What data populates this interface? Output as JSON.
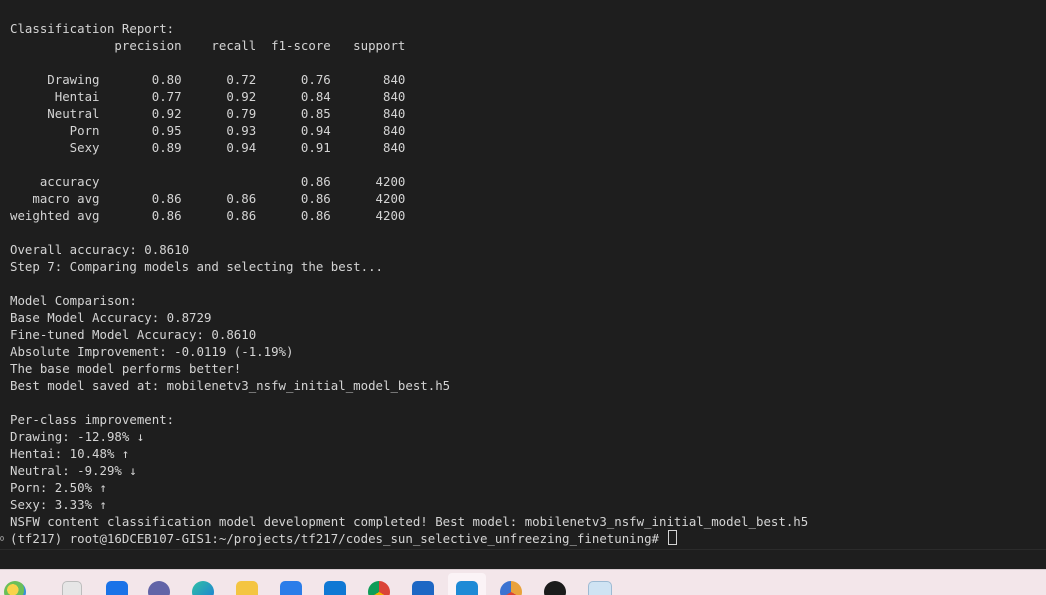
{
  "terminal": {
    "lines": [
      "Classification Report:",
      "              precision    recall  f1-score   support",
      "",
      "     Drawing       0.80      0.72      0.76       840",
      "      Hentai       0.77      0.92      0.84       840",
      "     Neutral       0.92      0.79      0.85       840",
      "        Porn       0.95      0.93      0.94       840",
      "        Sexy       0.89      0.94      0.91       840",
      "",
      "    accuracy                           0.86      4200",
      "   macro avg       0.86      0.86      0.86      4200",
      "weighted avg       0.86      0.86      0.86      4200",
      "",
      "Overall accuracy: 0.8610",
      "Step 7: Comparing models and selecting the best...",
      "",
      "Model Comparison:",
      "Base Model Accuracy: 0.8729",
      "Fine-tuned Model Accuracy: 0.8610",
      "Absolute Improvement: -0.0119 (-1.19%)",
      "The base model performs better!",
      "Best model saved at: mobilenetv3_nsfw_initial_model_best.h5",
      "",
      "Per-class improvement:",
      "Drawing: -12.98% ↓",
      "Hentai: 10.48% ↑",
      "Neutral: -9.29% ↓",
      "Porn: 2.50% ↑",
      "Sexy: 3.33% ↑",
      "NSFW content classification model development completed! Best model: mobilenetv3_nsfw_initial_model_best.h5"
    ],
    "prompt": "(tf217) root@16DCEB107-GIS1:~/projects/tf217/codes_sun_selective_unfreezing_finetuning# "
  },
  "taskbar": {
    "icons": [
      "photos-icon",
      "apps-icon",
      "file-explorer-icon",
      "teams-icon",
      "edge-icon",
      "folder-icon",
      "store-icon",
      "mail-icon",
      "chrome-icon",
      "defender-icon",
      "vscode-icon",
      "chrome-canary-icon",
      "qq-icon",
      "image-app-icon"
    ]
  }
}
